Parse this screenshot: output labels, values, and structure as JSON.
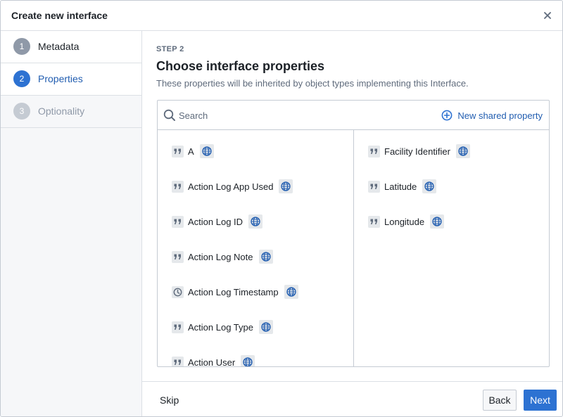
{
  "dialog": {
    "title": "Create new interface",
    "close_icon": "close-icon"
  },
  "sidebar": {
    "steps": [
      {
        "number": "1",
        "label": "Metadata",
        "state": "completed"
      },
      {
        "number": "2",
        "label": "Properties",
        "state": "active"
      },
      {
        "number": "3",
        "label": "Optionality",
        "state": "disabled"
      }
    ]
  },
  "main": {
    "step_caption": "STEP 2",
    "heading": "Choose interface properties",
    "subtitle": "These properties will be inherited by object types implementing this Interface."
  },
  "search": {
    "placeholder": "Search",
    "value": "",
    "icon": "search-icon"
  },
  "new_shared_property": {
    "label": "New shared property",
    "icon": "plus-circle-icon"
  },
  "properties_left": [
    {
      "name": "A",
      "type_icon": "quote-icon",
      "scope_icon": "globe-icon"
    },
    {
      "name": "Action Log App Used",
      "type_icon": "quote-icon",
      "scope_icon": "globe-icon"
    },
    {
      "name": "Action Log ID",
      "type_icon": "quote-icon",
      "scope_icon": "globe-icon"
    },
    {
      "name": "Action Log Note",
      "type_icon": "quote-icon",
      "scope_icon": "globe-icon"
    },
    {
      "name": "Action Log Timestamp",
      "type_icon": "clock-icon",
      "scope_icon": "globe-icon"
    },
    {
      "name": "Action Log Type",
      "type_icon": "quote-icon",
      "scope_icon": "globe-icon"
    },
    {
      "name": "Action User",
      "type_icon": "quote-icon",
      "scope_icon": "globe-icon"
    }
  ],
  "properties_right": [
    {
      "name": "Facility Identifier",
      "type_icon": "quote-icon",
      "scope_icon": "globe-icon"
    },
    {
      "name": "Latitude",
      "type_icon": "quote-icon",
      "scope_icon": "globe-icon"
    },
    {
      "name": "Longitude",
      "type_icon": "quote-icon",
      "scope_icon": "globe-icon"
    }
  ],
  "footer": {
    "skip_label": "Skip",
    "back_label": "Back",
    "next_label": "Next"
  },
  "colors": {
    "accent": "#2d72d2",
    "accent_text": "#215db0",
    "muted": "#5f6b7c",
    "border": "#c5cbd3"
  }
}
